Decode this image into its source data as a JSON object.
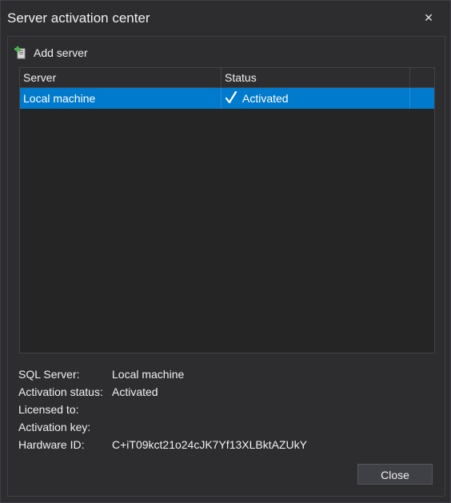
{
  "window": {
    "title": "Server activation center",
    "close_glyph": "✕"
  },
  "toolbar": {
    "add_server_label": "Add server",
    "add_server_icon": "add-server-icon"
  },
  "grid": {
    "columns": [
      "Server",
      "Status"
    ],
    "rows": [
      {
        "server": "Local machine",
        "status": "Activated",
        "status_icon": "checkmark-icon",
        "selected": true
      }
    ]
  },
  "details": [
    {
      "label": "SQL Server:",
      "value": "Local machine"
    },
    {
      "label": "Activation status:",
      "value": "Activated"
    },
    {
      "label": "Licensed to:",
      "value": ""
    },
    {
      "label": "Activation key:",
      "value": ""
    },
    {
      "label": "Hardware ID:",
      "value": "C+iT09kct21o24cJK7Yf13XLBktAZUkY"
    }
  ],
  "footer": {
    "close_label": "Close"
  },
  "colors": {
    "background": "#2d2d30",
    "selection": "#007acc",
    "grid_background": "#252526",
    "border": "#3f3f46"
  }
}
